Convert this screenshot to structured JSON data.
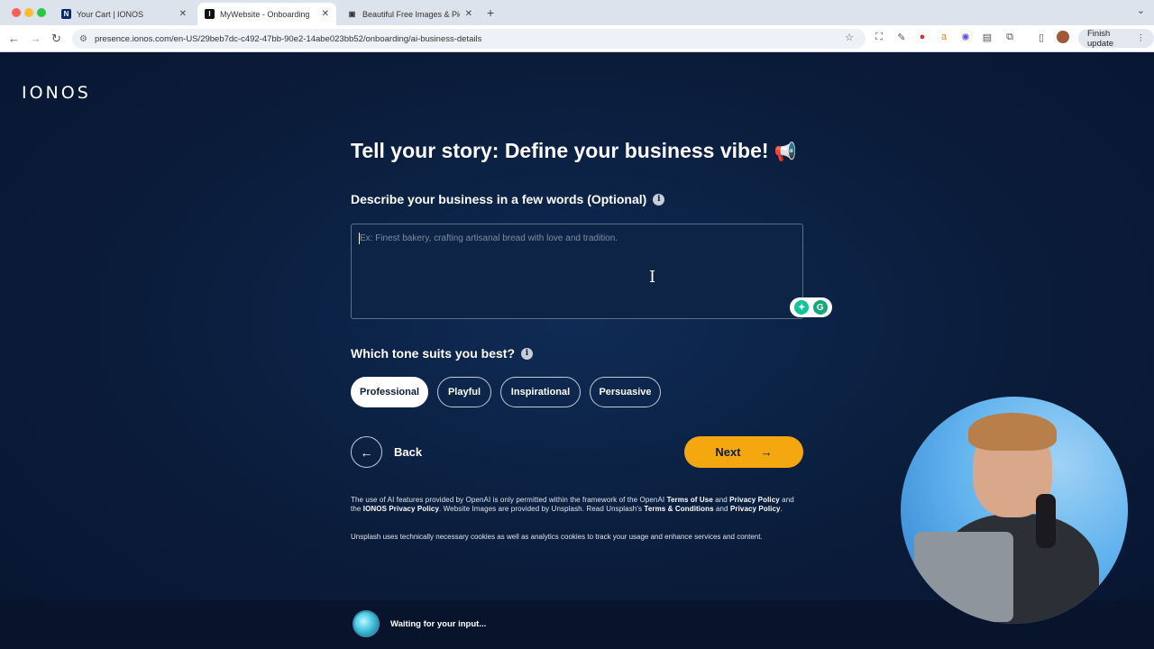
{
  "browser": {
    "tabs": [
      {
        "title": "Your Cart | IONOS",
        "favicon": "ionos-favicon",
        "active": false
      },
      {
        "title": "MyWebsite - Onboarding",
        "favicon": "ionos-favicon",
        "active": true
      },
      {
        "title": "Beautiful Free Images & Pictu",
        "favicon": "unsplash-favicon",
        "active": false
      }
    ],
    "url": "presence.ionos.com/en-US/29beb7dc-c492-47bb-90e2-14abe023bb52/onboarding/ai-business-details",
    "finish_update": "Finish update"
  },
  "page": {
    "logo": "IONOS",
    "headline": "Tell your story: Define your business vibe!",
    "description_label": "Describe your business in a few words (Optional)",
    "description_placeholder": "Ex: Finest bakery, crafting artisanal bread with love and tradition.",
    "tone_label": "Which tone suits you best?",
    "tones": [
      {
        "label": "Professional",
        "selected": true
      },
      {
        "label": "Playful",
        "selected": false
      },
      {
        "label": "Inspirational",
        "selected": false
      },
      {
        "label": "Persuasive",
        "selected": false
      }
    ],
    "back_label": "Back",
    "next_label": "Next",
    "legal": {
      "p1_a": "The use of AI features provided by OpenAI is only permitted within the framework of the OpenAI ",
      "terms_of_use": "Terms of Use",
      "and1": " and ",
      "privacy_policy": "Privacy Policy",
      "and_the": " and the ",
      "ionos_privacy": "IONOS Privacy Policy",
      "p1_b": ". Website Images are provided by Unsplash. Read Unsplash's ",
      "terms_conditions": "Terms & Conditions",
      "and2": " and ",
      "privacy_policy2": "Privacy Policy",
      "period": ".",
      "p2": "Unsplash uses technically necessary cookies as well as analytics cookies to track your usage and enhance services and content."
    },
    "status": "Waiting for your input..."
  },
  "colors": {
    "background": "#0b1e3a",
    "accent": "#f5a70f"
  }
}
